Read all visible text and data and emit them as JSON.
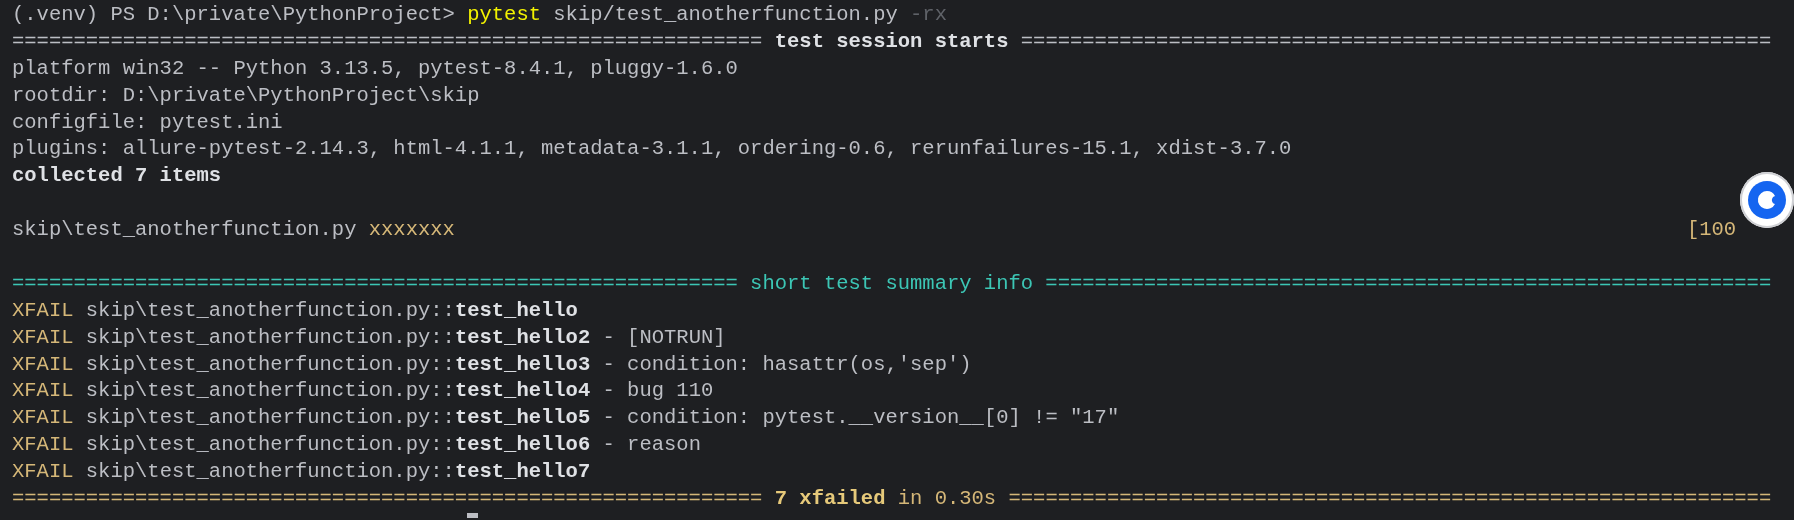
{
  "terminal": {
    "blocks": [
      [
        {
          "segments": [
            {
              "text": "(.venv) PS D:\\private\\PythonProject> ",
              "kind": "plain"
            },
            {
              "text": "pytest",
              "kind": "command"
            },
            {
              "text": " skip/test_anotherfunction.py ",
              "kind": "plain"
            },
            {
              "text": "-rx",
              "kind": "dim"
            }
          ]
        },
        {
          "segments": [
            {
              "text": "============================================================= ",
              "kind": "plain"
            },
            {
              "text": "test session starts",
              "kind": "bold"
            },
            {
              "text": " =============================================================",
              "kind": "plain"
            }
          ]
        },
        {
          "segments": [
            {
              "text": "platform win32 -- Python 3.13.5, pytest-8.4.1, pluggy-1.6.0",
              "kind": "plain"
            }
          ]
        },
        {
          "segments": [
            {
              "text": "rootdir: D:\\private\\PythonProject\\skip",
              "kind": "plain"
            }
          ]
        },
        {
          "segments": [
            {
              "text": "configfile: pytest.ini",
              "kind": "plain"
            }
          ]
        },
        {
          "segments": [
            {
              "text": "plugins: allure-pytest-2.14.3, html-4.1.1, metadata-3.1.1, ordering-0.6, rerunfailures-15.1, xdist-3.7.0",
              "kind": "plain"
            }
          ]
        },
        {
          "segments": [
            {
              "text": "collected 7 items",
              "kind": "bold"
            }
          ]
        }
      ],
      [
        {
          "segments": [
            {
              "text": "skip\\test_anotherfunction.py ",
              "kind": "plain"
            },
            {
              "text": "xxxxxxx",
              "kind": "yellow"
            }
          ],
          "progress": "[100"
        }
      ],
      [
        {
          "segments": [
            {
              "text": "=========================================================== short test summary info ===========================================================",
              "kind": "cyan"
            }
          ]
        },
        {
          "segments": [
            {
              "text": "XFAIL",
              "kind": "yellow"
            },
            {
              "text": " skip\\test_anotherfunction.py::",
              "kind": "plain"
            },
            {
              "text": "test_hello",
              "kind": "bold"
            }
          ]
        },
        {
          "segments": [
            {
              "text": "XFAIL",
              "kind": "yellow"
            },
            {
              "text": " skip\\test_anotherfunction.py::",
              "kind": "plain"
            },
            {
              "text": "test_hello2",
              "kind": "bold"
            },
            {
              "text": " - [NOTRUN]",
              "kind": "plain"
            }
          ]
        },
        {
          "segments": [
            {
              "text": "XFAIL",
              "kind": "yellow"
            },
            {
              "text": " skip\\test_anotherfunction.py::",
              "kind": "plain"
            },
            {
              "text": "test_hello3",
              "kind": "bold"
            },
            {
              "text": " - condition: hasattr(os,'sep')",
              "kind": "plain"
            }
          ]
        },
        {
          "segments": [
            {
              "text": "XFAIL",
              "kind": "yellow"
            },
            {
              "text": " skip\\test_anotherfunction.py::",
              "kind": "plain"
            },
            {
              "text": "test_hello4",
              "kind": "bold"
            },
            {
              "text": " - bug 110",
              "kind": "plain"
            }
          ]
        },
        {
          "segments": [
            {
              "text": "XFAIL",
              "kind": "yellow"
            },
            {
              "text": " skip\\test_anotherfunction.py::",
              "kind": "plain"
            },
            {
              "text": "test_hello5",
              "kind": "bold"
            },
            {
              "text": " - condition: pytest.__version__[0] != \"17\"",
              "kind": "plain"
            }
          ]
        },
        {
          "segments": [
            {
              "text": "XFAIL",
              "kind": "yellow"
            },
            {
              "text": " skip\\test_anotherfunction.py::",
              "kind": "plain"
            },
            {
              "text": "test_hello6",
              "kind": "bold"
            },
            {
              "text": " - reason",
              "kind": "plain"
            }
          ]
        },
        {
          "segments": [
            {
              "text": "XFAIL",
              "kind": "yellow"
            },
            {
              "text": " skip\\test_anotherfunction.py::",
              "kind": "plain"
            },
            {
              "text": "test_hello7",
              "kind": "bold"
            }
          ]
        },
        {
          "segments": [
            {
              "text": "============================================================= ",
              "kind": "yellow"
            },
            {
              "text": "7 xfailed",
              "kind": "yellow-bold"
            },
            {
              "text": " in 0.30s ==============================================================",
              "kind": "yellow"
            }
          ]
        }
      ]
    ]
  }
}
